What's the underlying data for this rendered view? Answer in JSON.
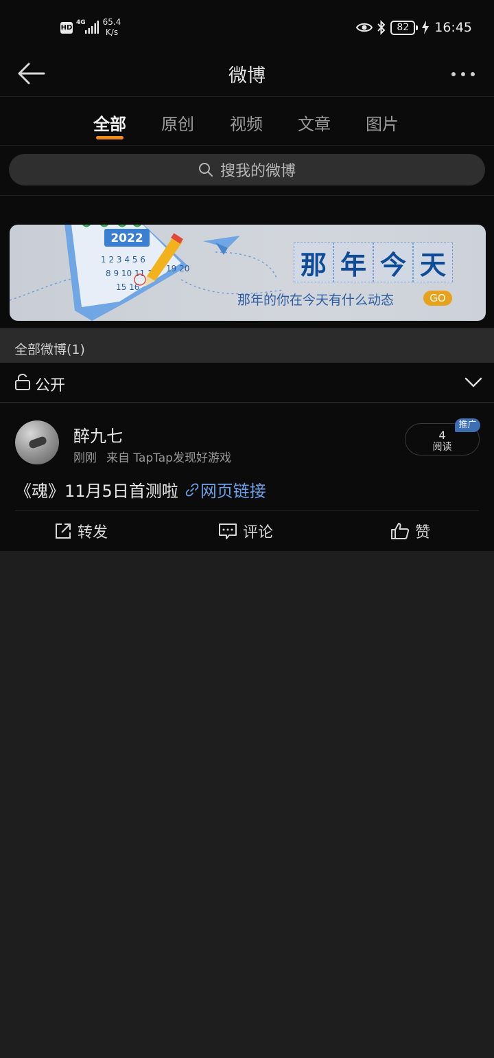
{
  "status_bar": {
    "hd_label": "HD",
    "signal_type": "4G",
    "net_speed_value": "65.4",
    "net_speed_unit": "K/s",
    "battery": "82",
    "time": "16:45"
  },
  "nav": {
    "title": "微博"
  },
  "tabs": [
    {
      "label": "全部",
      "active": true
    },
    {
      "label": "原创",
      "active": false
    },
    {
      "label": "视频",
      "active": false
    },
    {
      "label": "文章",
      "active": false
    },
    {
      "label": "图片",
      "active": false
    }
  ],
  "search": {
    "placeholder": "搜我的微博"
  },
  "banner": {
    "title_chars": [
      "那",
      "年",
      "今",
      "天"
    ],
    "subtitle": "那年的你在今天有什么动态",
    "go_label": "GO",
    "calendar_year": "2022"
  },
  "section": {
    "header": "全部微博(1)"
  },
  "filter": {
    "label": "公开"
  },
  "post": {
    "user_name": "醉九七",
    "time": "刚刚",
    "source": "来自 TapTap发现好游戏",
    "read_count": "4",
    "read_label": "阅读",
    "promo_tag": "推广",
    "text": "《魂》11月5日首测啦",
    "link_label": "网页链接",
    "actions": {
      "repost": "转发",
      "comment": "评论",
      "like": "赞"
    }
  },
  "colors": {
    "accent": "#f08a1e",
    "link": "#6a9ee6",
    "background": "#1e1e1e",
    "card": "#0b0b0b"
  }
}
